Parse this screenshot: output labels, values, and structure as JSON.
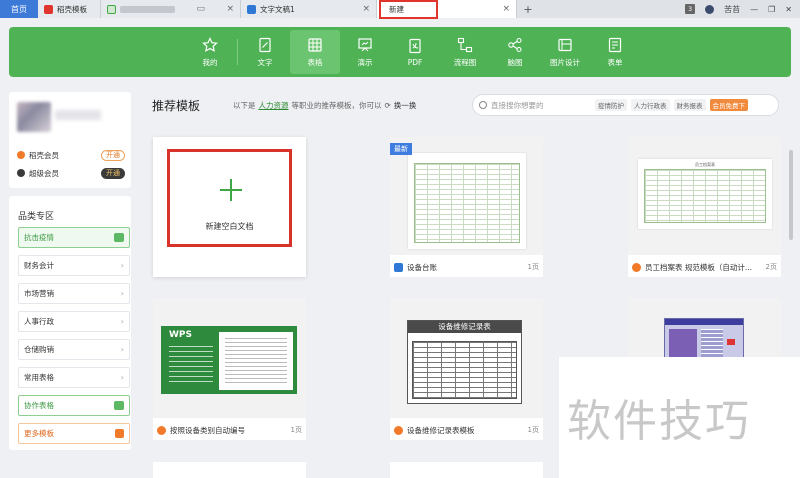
{
  "tabs": {
    "home": "首页",
    "daoke": "稻壳模板",
    "document": "文字文稿1",
    "new": "新建",
    "plus": "+",
    "close": "×"
  },
  "window": {
    "badge": "3",
    "username": "苦苔",
    "minimize": "—",
    "restore": "❐",
    "close": "✕"
  },
  "categories": [
    {
      "label": "我的",
      "icon": "star-icon"
    },
    {
      "label": "文字",
      "icon": "document-icon"
    },
    {
      "label": "表格",
      "icon": "table-icon",
      "active": true
    },
    {
      "label": "演示",
      "icon": "presentation-icon"
    },
    {
      "label": "PDF",
      "icon": "pdf-icon"
    },
    {
      "label": "流程图",
      "icon": "flowchart-icon"
    },
    {
      "label": "脑图",
      "icon": "mindmap-icon"
    },
    {
      "label": "图片设计",
      "icon": "image-design-icon"
    },
    {
      "label": "表单",
      "icon": "form-icon"
    }
  ],
  "user": {
    "vip1_label": "稻壳会员",
    "vip1_action": "开通",
    "vip2_label": "超级会员",
    "vip2_action": "开通"
  },
  "sidebar": {
    "title": "品类专区",
    "items": [
      {
        "label": "抗击疫情",
        "style": "green"
      },
      {
        "label": "财务会计"
      },
      {
        "label": "市场营销"
      },
      {
        "label": "人事行政"
      },
      {
        "label": "仓储购销"
      },
      {
        "label": "常用表格"
      },
      {
        "label": "协作表格",
        "style": "green2"
      },
      {
        "label": "更多模板",
        "style": "orange"
      }
    ]
  },
  "main": {
    "title": "推荐模板",
    "sub_prefix": "以下是",
    "sub_link": "人力资源",
    "sub_suffix": "等职业的推荐模板，你可以",
    "refresh": "换一换",
    "search_placeholder": "直接搜你想要的",
    "search_tags": [
      "疫情防护",
      "人力行政表",
      "财务报表"
    ],
    "search_promo": "会员免费下"
  },
  "cards": {
    "blank": "新建空白文档",
    "new_badge": "最新",
    "c1_title": "设备台账",
    "c1_pages": "1页",
    "c2_title": "员工档案表 规范模板（自动计...",
    "c2_pages": "2页",
    "c3_title": "按照设备类别自动编号",
    "c3_pages": "1页",
    "c4_title": "设备维修记录表模板",
    "c4_pages": "1页",
    "repair_header": "设备维修记录表",
    "employee_header": "员工档案表",
    "mps_logo": "WPS"
  },
  "watermark": "软件技巧",
  "colors": {
    "accent_green": "#4fb356",
    "highlight_red": "#d8332b",
    "home_tab_blue": "#3d7ad8"
  }
}
